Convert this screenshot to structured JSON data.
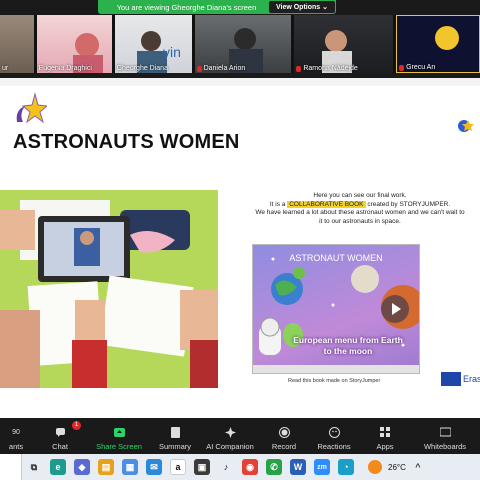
{
  "banner": {
    "text": "You are viewing Gheorghe Diana's screen",
    "options_label": "View Options"
  },
  "participants": [
    {
      "name": "ur",
      "muted": false
    },
    {
      "name": "Eugenia Draghici",
      "muted": false
    },
    {
      "name": "Gheorghe Diana",
      "muted": false
    },
    {
      "name": "Daniela Arion",
      "muted": true
    },
    {
      "name": "Ramona Nădejde",
      "muted": true
    },
    {
      "name": "Grecu An",
      "muted": true
    }
  ],
  "slide": {
    "title": "ASTRONAUTS WOMEN",
    "desc_line1": "Here you can see our final work.",
    "desc_line2_pre": "It is a",
    "desc_highlight": "COLLABORATIVE BOOK",
    "desc_line2_post": "created by STORYJUMPER.",
    "desc_line3": "We have learned a lot about these astronaut women and we can't wait to",
    "desc_line4": "it to our astronauts in space.",
    "book_title": "ASTRONAUT WOMEN",
    "book_subtitle": "European menu from Earth to the moon",
    "book_caption": "Read this book made on StoryJumper",
    "erasmus_label": "Eras"
  },
  "toolbar": [
    {
      "label": "ants",
      "icon": "participants-icon",
      "count": "90"
    },
    {
      "label": "Chat",
      "icon": "chat-icon",
      "badge": "1"
    },
    {
      "label": "Share Screen",
      "icon": "share-screen-icon"
    },
    {
      "label": "Summary",
      "icon": "summary-icon"
    },
    {
      "label": "AI Companion",
      "icon": "ai-companion-icon"
    },
    {
      "label": "Record",
      "icon": "record-icon"
    },
    {
      "label": "Reactions",
      "icon": "reactions-icon"
    },
    {
      "label": "Apps",
      "icon": "apps-icon"
    },
    {
      "label": "Whiteboards",
      "icon": "whiteboards-icon"
    }
  ],
  "taskbar": {
    "temperature": "26°C",
    "zoom_label": "zm"
  },
  "colors": {
    "zoom_green": "#2bb24c",
    "highlight": "#f2d12a",
    "mute_red": "#e02828"
  }
}
